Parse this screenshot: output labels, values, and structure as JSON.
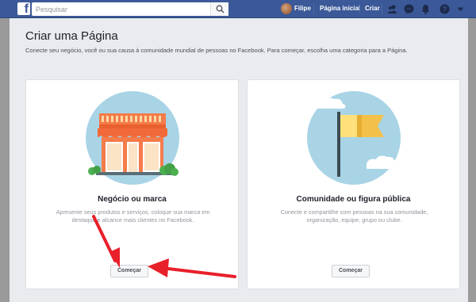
{
  "topbar": {
    "logo": "f",
    "search_placeholder": "Pesquisar",
    "user_name": "Filipe",
    "home_label": "Página inicial",
    "create_label": "Criar",
    "icons": [
      "friends-icon",
      "messenger-icon",
      "notifications-icon",
      "help-icon",
      "dropdown-icon"
    ]
  },
  "page": {
    "title": "Criar uma Página",
    "subtitle": "Conecte seu negócio, você ou sua causa à comunidade mundial de pessoas no Facebook. Para começar, escolha uma categoria para a Página."
  },
  "cards": [
    {
      "title": "Negócio ou marca",
      "description": "Apresente seus produtos e serviços, coloque sua marca em destaque e alcance mais clientes no Facebook.",
      "button": "Começar",
      "illustration": "storefront-icon"
    },
    {
      "title": "Comunidade ou figura pública",
      "description": "Conecte e compartilhe com pessoas na sua comunidade, organização, equipe, grupo ou clube.",
      "button": "Começar",
      "illustration": "flag-icon"
    }
  ],
  "colors": {
    "brand": "#3b5998",
    "annotation_arrow": "#e8202a",
    "illustration_bg": "#a8d4e6"
  }
}
